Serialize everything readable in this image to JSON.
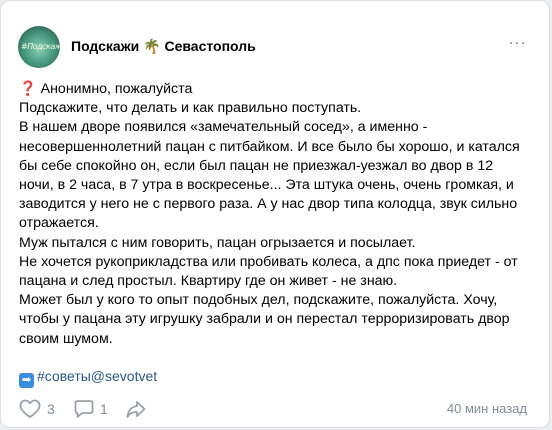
{
  "header": {
    "avatar_text": "#Подскажи",
    "group_name_a": "Подскажи ",
    "palm_icon": "🌴",
    "group_name_b": " Севастополь",
    "more_icon": "⋯"
  },
  "post": {
    "lines": [
      "Анонимно, пожалуйста",
      "Подскажите, что делать и как правильно поступать.",
      "В нашем дворе появился «замечательный сосед», а именно -",
      "несовершеннолетний пацан с питбайком. И все было бы хорошо, и катался",
      "бы себе спокойно он, если был пацан не приезжал-уезжал во двор в 12",
      "ночи, в 2 часа, в 7 утра в воскресенье... Эта штука очень, очень громкая, и",
      "заводится у него не с первого раза. А у нас двор типа колодца, звук сильно",
      "отражается.",
      "Муж пытался с ним говорить, пацан огрызается и посылает.",
      "Не хочется рукоприкладства или пробивать колеса, а дпс пока приедет - от",
      "пацана и след простыл. Квартиру где он живет - не знаю.",
      "Может был у кого то опыт подобных дел, подскажите, пожалуйста. Хочу,",
      "чтобы у пацана эту игрушку забрали и он перестал терроризировать двор",
      "своим шумом."
    ],
    "question_mark": "❓",
    "tag_arrow": "➡",
    "tag_text": "#советы@sevotvet"
  },
  "footer": {
    "likes": "3",
    "comments": "1",
    "time": "40 мин назад"
  },
  "colors": {
    "accent": "#2a5885",
    "muted": "#818c99",
    "page_bg": "#edeef0"
  }
}
